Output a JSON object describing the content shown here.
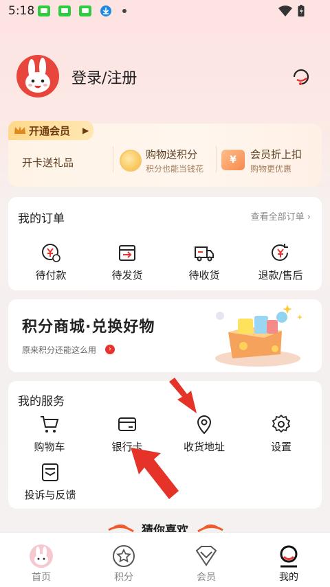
{
  "status_bar": {
    "time": "5:18",
    "icons": [
      "wechat-icon",
      "wechat-icon",
      "wechat-icon",
      "download-icon",
      "dot-icon",
      "wifi-icon",
      "battery-icon"
    ]
  },
  "header": {
    "login_label": "登录/注册",
    "avatar_icon": "rabbit-avatar",
    "service_icon": "headset-icon"
  },
  "vip": {
    "tag_label": "开通会员",
    "tag_arrow": "▶",
    "gift_label": "开卡送礼品",
    "points_title": "购物送积分",
    "points_sub": "积分也能当钱花",
    "discount_title": "会员折上扣",
    "discount_sub": "购物更优惠",
    "coupon_symbol": "¥"
  },
  "orders": {
    "title": "我的订单",
    "see_all": "查看全部订单 ›",
    "items": [
      {
        "label": "待付款",
        "icon": "yen-clock-icon"
      },
      {
        "label": "待发货",
        "icon": "box-arrow-icon"
      },
      {
        "label": "待收货",
        "icon": "truck-icon"
      },
      {
        "label": "退款/售后",
        "icon": "yen-return-icon"
      }
    ]
  },
  "mall": {
    "title": "积分商城·兑换好物",
    "subtitle": "原来积分还能这么用",
    "go_symbol": "›"
  },
  "services": {
    "title": "我的服务",
    "items": [
      {
        "label": "购物车",
        "icon": "cart-icon"
      },
      {
        "label": "银行卡",
        "icon": "card-icon"
      },
      {
        "label": "收货地址",
        "icon": "location-pin-icon"
      },
      {
        "label": "设置",
        "icon": "gear-icon"
      },
      {
        "label": "投诉与反馈",
        "icon": "feedback-icon"
      }
    ]
  },
  "guess": {
    "title": "猜你喜欢"
  },
  "tabbar": {
    "tabs": [
      {
        "label": "首页",
        "icon": "rabbit-home-icon",
        "active": false
      },
      {
        "label": "积分",
        "icon": "star-icon",
        "active": false
      },
      {
        "label": "会员",
        "icon": "vip-diamond-icon",
        "active": false
      },
      {
        "label": "我的",
        "icon": "user-smile-icon",
        "active": true
      }
    ]
  },
  "colors": {
    "accent": "#e8322e",
    "gold": "#f5b73b",
    "vip_text": "#6b3a13"
  }
}
